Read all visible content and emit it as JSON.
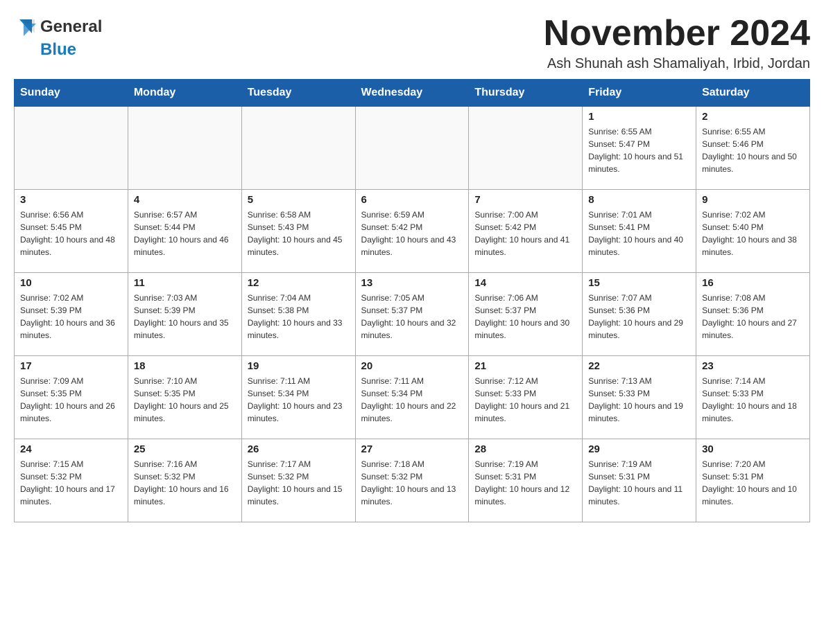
{
  "header": {
    "logo_general": "General",
    "logo_blue": "Blue",
    "month_title": "November 2024",
    "location": "Ash Shunah ash Shamaliyah, Irbid, Jordan"
  },
  "days_of_week": [
    "Sunday",
    "Monday",
    "Tuesday",
    "Wednesday",
    "Thursday",
    "Friday",
    "Saturday"
  ],
  "weeks": [
    [
      {
        "day": "",
        "info": ""
      },
      {
        "day": "",
        "info": ""
      },
      {
        "day": "",
        "info": ""
      },
      {
        "day": "",
        "info": ""
      },
      {
        "day": "",
        "info": ""
      },
      {
        "day": "1",
        "info": "Sunrise: 6:55 AM\nSunset: 5:47 PM\nDaylight: 10 hours and 51 minutes."
      },
      {
        "day": "2",
        "info": "Sunrise: 6:55 AM\nSunset: 5:46 PM\nDaylight: 10 hours and 50 minutes."
      }
    ],
    [
      {
        "day": "3",
        "info": "Sunrise: 6:56 AM\nSunset: 5:45 PM\nDaylight: 10 hours and 48 minutes."
      },
      {
        "day": "4",
        "info": "Sunrise: 6:57 AM\nSunset: 5:44 PM\nDaylight: 10 hours and 46 minutes."
      },
      {
        "day": "5",
        "info": "Sunrise: 6:58 AM\nSunset: 5:43 PM\nDaylight: 10 hours and 45 minutes."
      },
      {
        "day": "6",
        "info": "Sunrise: 6:59 AM\nSunset: 5:42 PM\nDaylight: 10 hours and 43 minutes."
      },
      {
        "day": "7",
        "info": "Sunrise: 7:00 AM\nSunset: 5:42 PM\nDaylight: 10 hours and 41 minutes."
      },
      {
        "day": "8",
        "info": "Sunrise: 7:01 AM\nSunset: 5:41 PM\nDaylight: 10 hours and 40 minutes."
      },
      {
        "day": "9",
        "info": "Sunrise: 7:02 AM\nSunset: 5:40 PM\nDaylight: 10 hours and 38 minutes."
      }
    ],
    [
      {
        "day": "10",
        "info": "Sunrise: 7:02 AM\nSunset: 5:39 PM\nDaylight: 10 hours and 36 minutes."
      },
      {
        "day": "11",
        "info": "Sunrise: 7:03 AM\nSunset: 5:39 PM\nDaylight: 10 hours and 35 minutes."
      },
      {
        "day": "12",
        "info": "Sunrise: 7:04 AM\nSunset: 5:38 PM\nDaylight: 10 hours and 33 minutes."
      },
      {
        "day": "13",
        "info": "Sunrise: 7:05 AM\nSunset: 5:37 PM\nDaylight: 10 hours and 32 minutes."
      },
      {
        "day": "14",
        "info": "Sunrise: 7:06 AM\nSunset: 5:37 PM\nDaylight: 10 hours and 30 minutes."
      },
      {
        "day": "15",
        "info": "Sunrise: 7:07 AM\nSunset: 5:36 PM\nDaylight: 10 hours and 29 minutes."
      },
      {
        "day": "16",
        "info": "Sunrise: 7:08 AM\nSunset: 5:36 PM\nDaylight: 10 hours and 27 minutes."
      }
    ],
    [
      {
        "day": "17",
        "info": "Sunrise: 7:09 AM\nSunset: 5:35 PM\nDaylight: 10 hours and 26 minutes."
      },
      {
        "day": "18",
        "info": "Sunrise: 7:10 AM\nSunset: 5:35 PM\nDaylight: 10 hours and 25 minutes."
      },
      {
        "day": "19",
        "info": "Sunrise: 7:11 AM\nSunset: 5:34 PM\nDaylight: 10 hours and 23 minutes."
      },
      {
        "day": "20",
        "info": "Sunrise: 7:11 AM\nSunset: 5:34 PM\nDaylight: 10 hours and 22 minutes."
      },
      {
        "day": "21",
        "info": "Sunrise: 7:12 AM\nSunset: 5:33 PM\nDaylight: 10 hours and 21 minutes."
      },
      {
        "day": "22",
        "info": "Sunrise: 7:13 AM\nSunset: 5:33 PM\nDaylight: 10 hours and 19 minutes."
      },
      {
        "day": "23",
        "info": "Sunrise: 7:14 AM\nSunset: 5:33 PM\nDaylight: 10 hours and 18 minutes."
      }
    ],
    [
      {
        "day": "24",
        "info": "Sunrise: 7:15 AM\nSunset: 5:32 PM\nDaylight: 10 hours and 17 minutes."
      },
      {
        "day": "25",
        "info": "Sunrise: 7:16 AM\nSunset: 5:32 PM\nDaylight: 10 hours and 16 minutes."
      },
      {
        "day": "26",
        "info": "Sunrise: 7:17 AM\nSunset: 5:32 PM\nDaylight: 10 hours and 15 minutes."
      },
      {
        "day": "27",
        "info": "Sunrise: 7:18 AM\nSunset: 5:32 PM\nDaylight: 10 hours and 13 minutes."
      },
      {
        "day": "28",
        "info": "Sunrise: 7:19 AM\nSunset: 5:31 PM\nDaylight: 10 hours and 12 minutes."
      },
      {
        "day": "29",
        "info": "Sunrise: 7:19 AM\nSunset: 5:31 PM\nDaylight: 10 hours and 11 minutes."
      },
      {
        "day": "30",
        "info": "Sunrise: 7:20 AM\nSunset: 5:31 PM\nDaylight: 10 hours and 10 minutes."
      }
    ]
  ]
}
